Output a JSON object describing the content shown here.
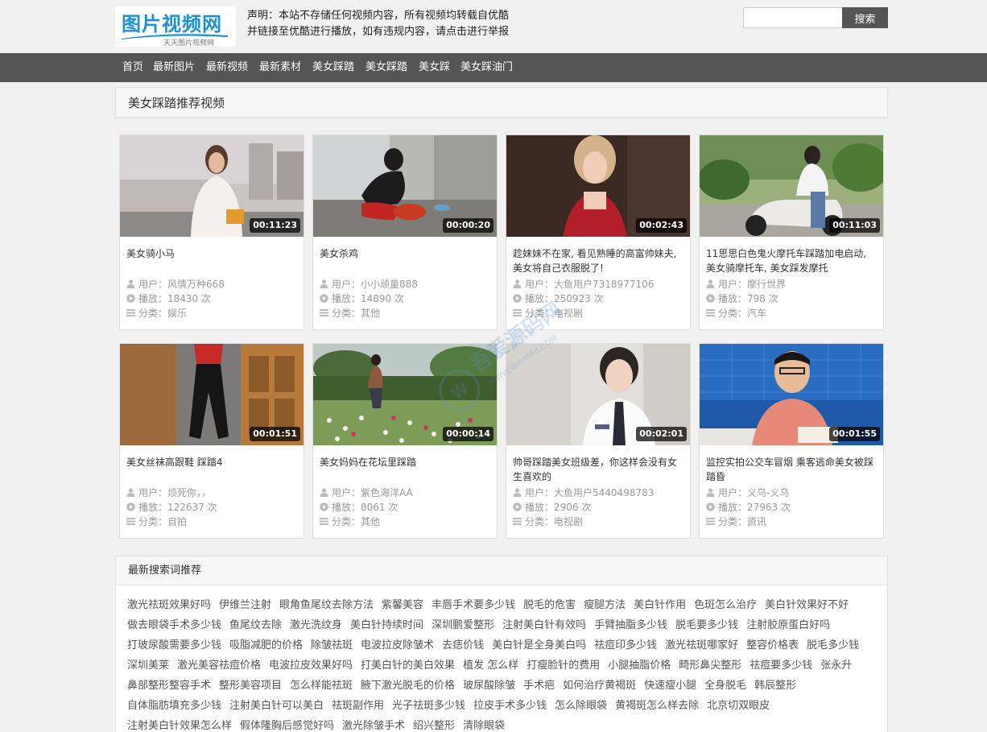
{
  "site": {
    "logo_text": "图片视频网",
    "logo_sub": "天天图片视频网",
    "notice_line1": "声明：本站不存储任何视频内容，所有视频均转载自优酷",
    "notice_line2": "并链接至优酷进行播放，如有违规内容，请点击进行举报",
    "search_placeholder": "",
    "search_button": "搜索"
  },
  "nav": [
    "首页",
    "最新图片",
    "最新视频",
    "最新素材",
    "美女踩踏",
    "美女踩踏",
    "美女踩",
    "美女踩油门"
  ],
  "section_title": "美女踩踏推荐视频",
  "labels": {
    "user": "用户：",
    "plays": "播放：",
    "category": "分类：",
    "times": " 次"
  },
  "videos": [
    {
      "title": "美女骑小马",
      "duration": "00:11:23",
      "user": "风情万种668",
      "plays": "18430",
      "category": "娱乐"
    },
    {
      "title": "美女杀鸡",
      "duration": "00:00:20",
      "user": "小小顽童888",
      "plays": "14890",
      "category": "其他"
    },
    {
      "title": "趁妹妹不在家, 看见熟睡的高富帅妹夫, 美女将自己衣服脱了!",
      "duration": "00:02:43",
      "user": "大鱼用户7318977106",
      "plays": "250923",
      "category": "电视剧"
    },
    {
      "title": "11思思白色鬼火摩托车踩踏加电启动, 美女骑摩托车, 美女踩发摩托",
      "duration": "00:11:03",
      "user": "摩行世界",
      "plays": "798",
      "category": "汽车"
    },
    {
      "title": "美女丝袜高跟鞋 踩踏4",
      "duration": "00:01:51",
      "user": "烦死你，，",
      "plays": "122637",
      "category": "自拍"
    },
    {
      "title": "美女妈妈在花坛里踩踏",
      "duration": "00:00:14",
      "user": "紫色海洋AA",
      "plays": "8061",
      "category": "其他"
    },
    {
      "title": "帅哥踩踏美女班级差，你这样会没有女生喜欢的",
      "duration": "00:02:01",
      "user": "大鱼用户5440498783",
      "plays": "2906",
      "category": "电视剧"
    },
    {
      "title": "监控实拍公交车冒烟 乘客逃命美女被踩踏昏",
      "duration": "00:01:55",
      "user": "义乌-义乌",
      "plays": "27963",
      "category": "资讯"
    }
  ],
  "keywords_title": "最新搜索词推荐",
  "keywords": [
    "激光祛斑效果好吗",
    "伊维兰注射",
    "眼角鱼尾纹去除方法",
    "紫馨美容",
    "丰唇手术要多少钱",
    "脱毛的危害",
    "瘦腿方法",
    "美白针作用",
    "色斑怎么治疗",
    "美白针效果好不好",
    "做去眼袋手术多少钱",
    "鱼尾纹去除",
    "激光洗纹身",
    "美白针持续时间",
    "深圳鹏爱整形",
    "注射美白针有效吗",
    "手臂抽脂多少钱",
    "脱毛要多少钱",
    "注射胶原蛋白好吗",
    "打玻尿酸需要多少钱",
    "吸脂减肥的价格",
    "除皱祛斑",
    "电波拉皮除皱术",
    "去痣价钱",
    "美白针是全身美白吗",
    "祛痘印多少钱",
    "激光祛斑哪家好",
    "整容价格表",
    "脱毛多少钱",
    "深圳美莱",
    "激光美容祛痘价格",
    "电波拉皮效果好吗",
    "打美白针的美白效果",
    "植发 怎么样",
    "打瘦脸针的费用",
    "小腿抽脂价格",
    "畸形鼻尖整形",
    "祛痘要多少钱",
    "张永升",
    "鼻部整形整容手术",
    "整形美容项目",
    "怎么样能祛斑",
    "腋下激光脱毛的价格",
    "玻尿酸除皱",
    "手术疤",
    "如何治疗黄褐斑",
    "快速瘦小腿",
    "全身脱毛",
    "韩辰整形",
    "自体脂肪填充多少钱",
    "注射美白针可以美白",
    "祛斑副作用",
    "光子祛斑多少钱",
    "拉皮手术多少钱",
    "怎么除眼袋",
    "黄褐斑怎么样去除",
    "北京切双眼皮",
    "注射美白针效果怎么样",
    "假体隆胸后感觉好吗",
    "激光除皱手术",
    "绍兴整形",
    "清除眼袋"
  ],
  "watermark_text": "吾爱源码网",
  "watermark_url": "WWW.WAYM68.COM",
  "colors": {
    "nav_bg": "#555555",
    "logo_blue": "#1a8fd6",
    "page_bg": "#f1f1f1"
  }
}
